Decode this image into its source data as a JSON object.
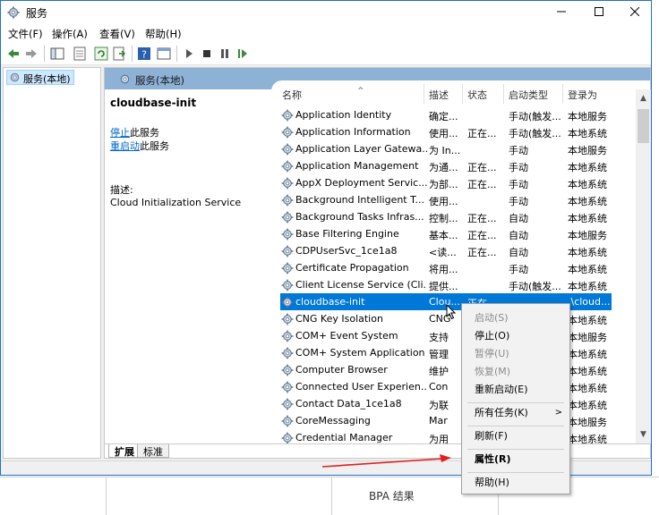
{
  "window": {
    "title": "服务"
  },
  "menubar": {
    "items": [
      "文件(F)",
      "操作(A)",
      "查看(V)",
      "帮助(H)"
    ]
  },
  "tree": {
    "item": "服务(本地)"
  },
  "pane": {
    "header": "服务(本地)"
  },
  "description": {
    "service_name": "cloudbase-init",
    "stop_link": "停止",
    "stop_suffix": "此服务",
    "restart_link": "重启动",
    "restart_suffix": "此服务",
    "desc_label": "描述:",
    "desc_text": "Cloud Initialization Service"
  },
  "columns": {
    "name": "名称",
    "desc": "描述",
    "status": "状态",
    "startup": "启动类型",
    "logon": "登录为"
  },
  "services": [
    {
      "name": "Application Identity",
      "desc": "确定...",
      "status": "",
      "startup": "手动(触发...",
      "logon": "本地服务"
    },
    {
      "name": "Application Information",
      "desc": "使用...",
      "status": "正在...",
      "startup": "手动(触发...",
      "logon": "本地系统"
    },
    {
      "name": "Application Layer Gatewa...",
      "desc": "为 In...",
      "status": "",
      "startup": "手动",
      "logon": "本地服务"
    },
    {
      "name": "Application Management",
      "desc": "为通...",
      "status": "正在...",
      "startup": "手动",
      "logon": "本地系统"
    },
    {
      "name": "AppX Deployment Servic...",
      "desc": "为部...",
      "status": "正在...",
      "startup": "手动",
      "logon": "本地系统"
    },
    {
      "name": "Background Intelligent T...",
      "desc": "使用...",
      "status": "",
      "startup": "手动",
      "logon": "本地系统"
    },
    {
      "name": "Background Tasks Infras...",
      "desc": "控制...",
      "status": "正在...",
      "startup": "自动",
      "logon": "本地系统"
    },
    {
      "name": "Base Filtering Engine",
      "desc": "基本...",
      "status": "正在...",
      "startup": "自动",
      "logon": "本地服务"
    },
    {
      "name": "CDPUserSvc_1ce1a8",
      "desc": "<读...",
      "status": "正在...",
      "startup": "自动",
      "logon": "本地系统"
    },
    {
      "name": "Certificate Propagation",
      "desc": "将用...",
      "status": "",
      "startup": "手动",
      "logon": "本地系统"
    },
    {
      "name": "Client License Service (Cli...",
      "desc": "提供...",
      "status": "",
      "startup": "手动(触发...",
      "logon": "本地系统"
    },
    {
      "name": "cloudbase-init",
      "desc": "Clou...",
      "status": "正在...",
      "startup": "",
      "logon": ".\\cloud..."
    },
    {
      "name": "CNG Key Isolation",
      "desc": "CNG",
      "status": "",
      "startup": "",
      "logon": "本地系统"
    },
    {
      "name": "COM+ Event System",
      "desc": "支持",
      "status": "",
      "startup": "",
      "logon": "本地服务"
    },
    {
      "name": "COM+ System Application",
      "desc": "管理",
      "status": "",
      "startup": "",
      "logon": "本地系统"
    },
    {
      "name": "Computer Browser",
      "desc": "维护",
      "status": "",
      "startup": "",
      "logon": "本地系统"
    },
    {
      "name": "Connected User Experien...",
      "desc": "Con",
      "status": "",
      "startup": "",
      "logon": "本地系统"
    },
    {
      "name": "Contact Data_1ce1a8",
      "desc": "为联",
      "status": "",
      "startup": "",
      "logon": "本地系统"
    },
    {
      "name": "CoreMessaging",
      "desc": "Mar",
      "status": "",
      "startup": "",
      "logon": "本地服务"
    },
    {
      "name": "Credential Manager",
      "desc": "为用",
      "status": "",
      "startup": "",
      "logon": "本地系统"
    }
  ],
  "tabs": {
    "extended": "扩展",
    "standard": "标准"
  },
  "context_menu": {
    "start": "启动(S)",
    "stop": "停止(O)",
    "pause": "暂停(U)",
    "resume": "恢复(M)",
    "restart": "重新启动(E)",
    "all_tasks": "所有任务(K)",
    "refresh": "刷新(F)",
    "properties": "属性(R)",
    "help": "帮助(H)"
  },
  "background": {
    "bpa_text": "BPA 结果"
  },
  "colors": {
    "selection": "#0078d7",
    "header": "#8eb1d6",
    "annotation_arrow": "#e02020",
    "link": "#0066cc"
  },
  "icons": {
    "service": "gear-icon",
    "title": "services-gear-icon"
  }
}
